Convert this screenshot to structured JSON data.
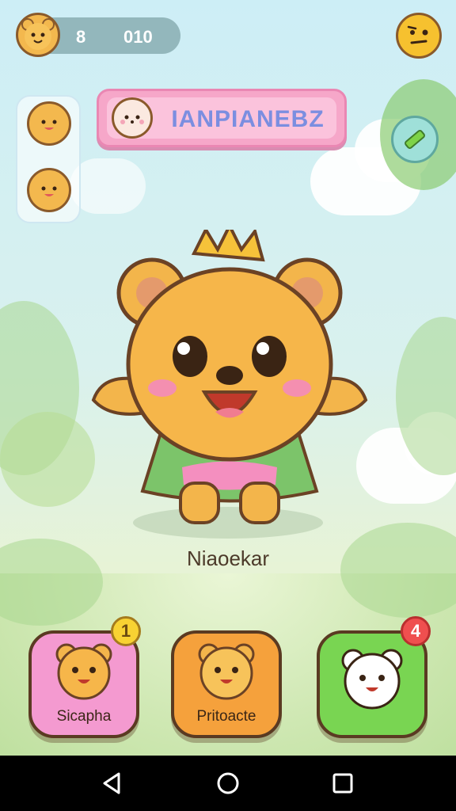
{
  "hud": {
    "coins": "8",
    "score": "010"
  },
  "banner": {
    "title": "IANPIANEBZ"
  },
  "character": {
    "name": "Niaoekar"
  },
  "cards": [
    {
      "label": "Sicapha",
      "badge": "1"
    },
    {
      "label": "Pritoacte",
      "badge": ""
    },
    {
      "label": "",
      "badge": "4"
    }
  ],
  "icons": {
    "hud_avatar": "bear-face-icon",
    "emoji": "skeptical-face-icon",
    "edit": "pencil-icon",
    "nav_back": "triangle-back-icon",
    "nav_home": "circle-home-icon",
    "nav_recent": "square-recent-icon"
  },
  "colors": {
    "banner": "#f6a7c9",
    "banner_text": "#7b8ee0",
    "card_pink": "#f49ad0",
    "card_orange": "#f5a13c",
    "card_green": "#79d552"
  }
}
